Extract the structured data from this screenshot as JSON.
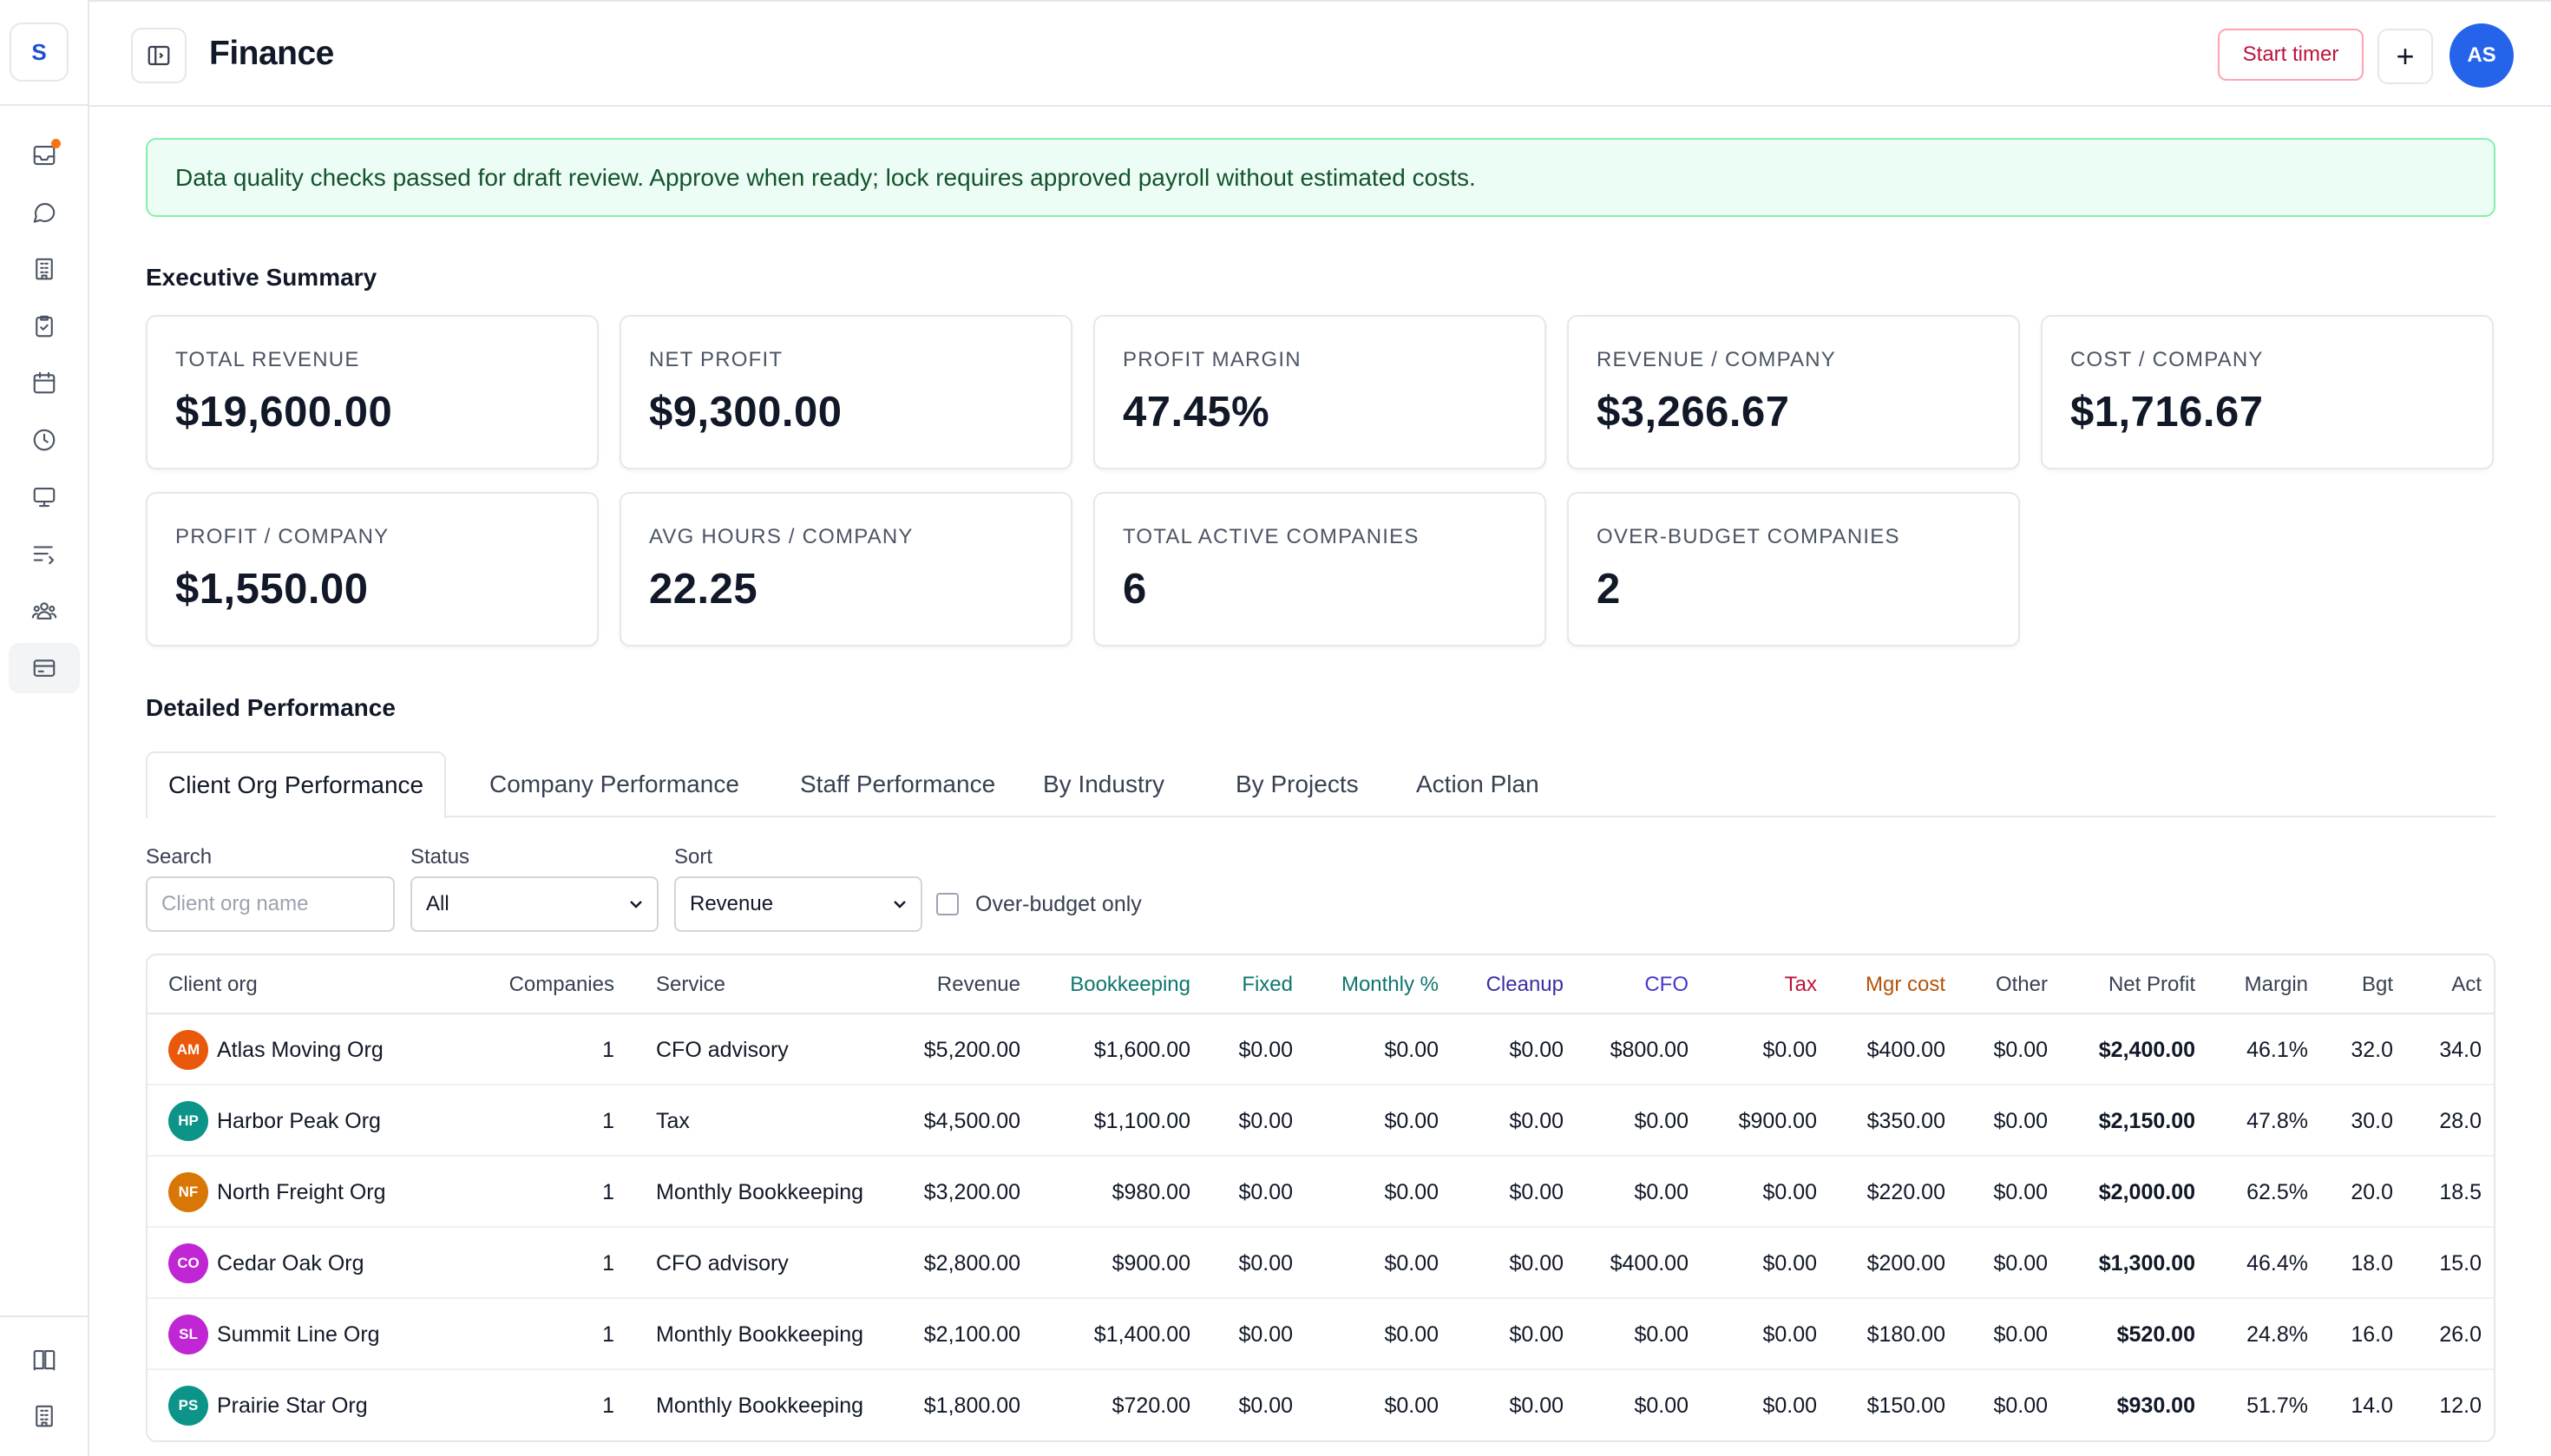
{
  "brand": {
    "letter": "S",
    "color": "#1d4ed8"
  },
  "sidebar": {
    "items": [
      {
        "name": "inbox-icon",
        "active": false,
        "badge": true
      },
      {
        "name": "chat-icon",
        "active": false
      },
      {
        "name": "building-icon",
        "active": false
      },
      {
        "name": "clipboard-check-icon",
        "active": false
      },
      {
        "name": "calendar-icon",
        "active": false
      },
      {
        "name": "clock-icon",
        "active": false
      },
      {
        "name": "monitor-icon",
        "active": false
      },
      {
        "name": "list-filter-icon",
        "active": false
      },
      {
        "name": "team-icon",
        "active": false
      },
      {
        "name": "credit-card-icon",
        "active": true
      }
    ],
    "bottom": [
      {
        "name": "book-icon"
      },
      {
        "name": "office-building-icon"
      }
    ]
  },
  "header": {
    "title": "Finance",
    "start_timer": "Start timer",
    "plus": "+",
    "avatar_initials": "AS",
    "avatar_color": "#2563eb"
  },
  "banner": {
    "text": "Data quality checks passed for draft review. Approve when ready; lock requires approved payroll without estimated costs."
  },
  "summary": {
    "heading": "Executive Summary",
    "cards": [
      {
        "label": "TOTAL REVENUE",
        "value": "$19,600.00"
      },
      {
        "label": "NET PROFIT",
        "value": "$9,300.00"
      },
      {
        "label": "PROFIT MARGIN",
        "value": "47.45%"
      },
      {
        "label": "REVENUE / COMPANY",
        "value": "$3,266.67"
      },
      {
        "label": "COST / COMPANY",
        "value": "$1,716.67"
      },
      {
        "label": "PROFIT / COMPANY",
        "value": "$1,550.00"
      },
      {
        "label": "AVG HOURS / COMPANY",
        "value": "22.25"
      },
      {
        "label": "TOTAL ACTIVE COMPANIES",
        "value": "6"
      },
      {
        "label": "OVER-BUDGET COMPANIES",
        "value": "2"
      }
    ]
  },
  "performance": {
    "heading": "Detailed Performance",
    "tabs": [
      {
        "label": "Client Org Performance",
        "active": true
      },
      {
        "label": "Company Performance",
        "active": false
      },
      {
        "label": "Staff Performance",
        "active": false
      },
      {
        "label": "By Industry",
        "active": false
      },
      {
        "label": "By Projects",
        "active": false
      },
      {
        "label": "Action Plan",
        "active": false
      }
    ]
  },
  "filters": {
    "search_label": "Search",
    "search_placeholder": "Client org name",
    "search_value": "",
    "status_label": "Status",
    "status_value": "All",
    "sort_label": "Sort",
    "sort_value": "Revenue",
    "over_budget_label": "Over-budget only",
    "over_budget_checked": false
  },
  "table": {
    "columns": [
      {
        "key": "org",
        "label": "Client org",
        "color": "#374151"
      },
      {
        "key": "companies",
        "label": "Companies",
        "color": "#374151"
      },
      {
        "key": "service",
        "label": "Service",
        "color": "#374151"
      },
      {
        "key": "revenue",
        "label": "Revenue",
        "color": "#374151"
      },
      {
        "key": "bookkeeping",
        "label": "Bookkeeping",
        "color": "#0f766e"
      },
      {
        "key": "fixed",
        "label": "Fixed",
        "color": "#0f766e"
      },
      {
        "key": "monthly_pct",
        "label": "Monthly %",
        "color": "#0f766e"
      },
      {
        "key": "cleanup",
        "label": "Cleanup",
        "color": "#3730a3"
      },
      {
        "key": "cfo",
        "label": "CFO",
        "color": "#4338ca"
      },
      {
        "key": "tax",
        "label": "Tax",
        "color": "#be123c"
      },
      {
        "key": "mgr_cost",
        "label": "Mgr cost",
        "color": "#b45309"
      },
      {
        "key": "other",
        "label": "Other",
        "color": "#374151"
      },
      {
        "key": "net_profit",
        "label": "Net Profit",
        "color": "#374151"
      },
      {
        "key": "margin",
        "label": "Margin",
        "color": "#374151"
      },
      {
        "key": "bgt",
        "label": "Bgt",
        "color": "#374151"
      },
      {
        "key": "act",
        "label": "Act",
        "color": "#374151"
      }
    ],
    "rows": [
      {
        "initials": "AM",
        "avatar_color": "#ea580c",
        "org": "Atlas Moving Org",
        "companies": "1",
        "service": "CFO advisory",
        "revenue": "$5,200.00",
        "bookkeeping": "$1,600.00",
        "fixed": "$0.00",
        "monthly_pct": "$0.00",
        "cleanup": "$0.00",
        "cfo": "$800.00",
        "tax": "$0.00",
        "mgr_cost": "$400.00",
        "other": "$0.00",
        "net_profit": "$2,400.00",
        "margin": "46.1%",
        "bgt": "32.0",
        "act": "34.0"
      },
      {
        "initials": "HP",
        "avatar_color": "#0d9488",
        "org": "Harbor Peak Org",
        "companies": "1",
        "service": "Tax",
        "revenue": "$4,500.00",
        "bookkeeping": "$1,100.00",
        "fixed": "$0.00",
        "monthly_pct": "$0.00",
        "cleanup": "$0.00",
        "cfo": "$0.00",
        "tax": "$900.00",
        "mgr_cost": "$350.00",
        "other": "$0.00",
        "net_profit": "$2,150.00",
        "margin": "47.8%",
        "bgt": "30.0",
        "act": "28.0"
      },
      {
        "initials": "NF",
        "avatar_color": "#d97706",
        "org": "North Freight Org",
        "companies": "1",
        "service": "Monthly Bookkeeping",
        "revenue": "$3,200.00",
        "bookkeeping": "$980.00",
        "fixed": "$0.00",
        "monthly_pct": "$0.00",
        "cleanup": "$0.00",
        "cfo": "$0.00",
        "tax": "$0.00",
        "mgr_cost": "$220.00",
        "other": "$0.00",
        "net_profit": "$2,000.00",
        "margin": "62.5%",
        "bgt": "20.0",
        "act": "18.5"
      },
      {
        "initials": "CO",
        "avatar_color": "#c026d3",
        "org": "Cedar Oak Org",
        "companies": "1",
        "service": "CFO advisory",
        "revenue": "$2,800.00",
        "bookkeeping": "$900.00",
        "fixed": "$0.00",
        "monthly_pct": "$0.00",
        "cleanup": "$0.00",
        "cfo": "$400.00",
        "tax": "$0.00",
        "mgr_cost": "$200.00",
        "other": "$0.00",
        "net_profit": "$1,300.00",
        "margin": "46.4%",
        "bgt": "18.0",
        "act": "15.0"
      },
      {
        "initials": "SL",
        "avatar_color": "#c026d3",
        "org": "Summit Line Org",
        "companies": "1",
        "service": "Monthly Bookkeeping",
        "revenue": "$2,100.00",
        "bookkeeping": "$1,400.00",
        "fixed": "$0.00",
        "monthly_pct": "$0.00",
        "cleanup": "$0.00",
        "cfo": "$0.00",
        "tax": "$0.00",
        "mgr_cost": "$180.00",
        "other": "$0.00",
        "net_profit": "$520.00",
        "margin": "24.8%",
        "bgt": "16.0",
        "act": "26.0"
      },
      {
        "initials": "PS",
        "avatar_color": "#0d9488",
        "org": "Prairie Star Org",
        "companies": "1",
        "service": "Monthly Bookkeeping",
        "revenue": "$1,800.00",
        "bookkeeping": "$720.00",
        "fixed": "$0.00",
        "monthly_pct": "$0.00",
        "cleanup": "$0.00",
        "cfo": "$0.00",
        "tax": "$0.00",
        "mgr_cost": "$150.00",
        "other": "$0.00",
        "net_profit": "$930.00",
        "margin": "51.7%",
        "bgt": "14.0",
        "act": "12.0"
      }
    ]
  }
}
